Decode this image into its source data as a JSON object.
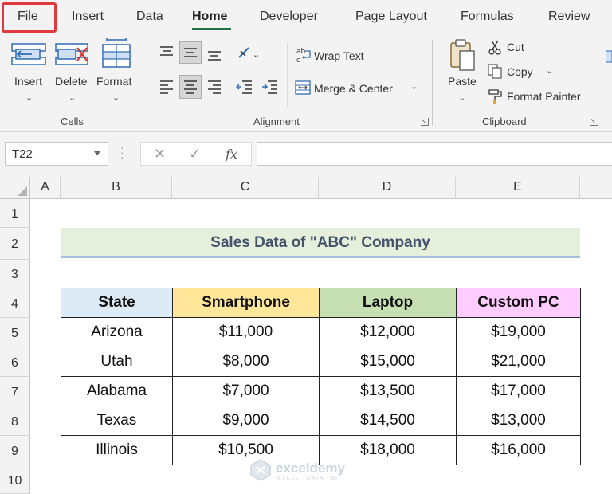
{
  "menu": {
    "tabs": [
      "File",
      "Insert",
      "Data",
      "Home",
      "Developer",
      "Page Layout",
      "Formulas",
      "Review"
    ],
    "active_tab": "Home"
  },
  "ribbon": {
    "cells": {
      "insert": "Insert",
      "delete": "Delete",
      "format": "Format",
      "group": "Cells"
    },
    "alignment": {
      "wrap_text": "Wrap Text",
      "merge_center": "Merge & Center",
      "group": "Alignment"
    },
    "clipboard": {
      "paste": "Paste",
      "cut": "Cut",
      "copy": "Copy",
      "format_painter": "Format Painter",
      "group": "Clipboard"
    }
  },
  "formula_bar": {
    "name_box": "T22",
    "fx": "fx",
    "cancel": "✕",
    "enter": "✓",
    "value": ""
  },
  "sheet": {
    "columns": [
      "A",
      "B",
      "C",
      "D",
      "E"
    ],
    "rows": [
      "1",
      "2",
      "3",
      "4",
      "5",
      "6",
      "7",
      "8",
      "9",
      "10"
    ],
    "title": "Sales Data of \"ABC\" Company",
    "headers": [
      "State",
      "Smartphone",
      "Laptop",
      "Custom PC"
    ],
    "data": [
      [
        "Arizona",
        "$11,000",
        "$12,000",
        "$19,000"
      ],
      [
        "Utah",
        "$8,000",
        "$15,000",
        "$21,000"
      ],
      [
        "Alabama",
        "$7,000",
        "$13,500",
        "$17,000"
      ],
      [
        "Texas",
        "$9,000",
        "$14,500",
        "$13,000"
      ],
      [
        "Illinois",
        "$10,500",
        "$18,000",
        "$16,000"
      ]
    ],
    "header_colors": [
      "#ddebf7",
      "#ffe699",
      "#c6e0b4",
      "#ffccff"
    ]
  },
  "watermark": {
    "name": "exceldemy",
    "tagline": "EXCEL · DATA · BI"
  },
  "colors": {
    "accent": "#217346",
    "highlight_box": "#e0393e"
  }
}
